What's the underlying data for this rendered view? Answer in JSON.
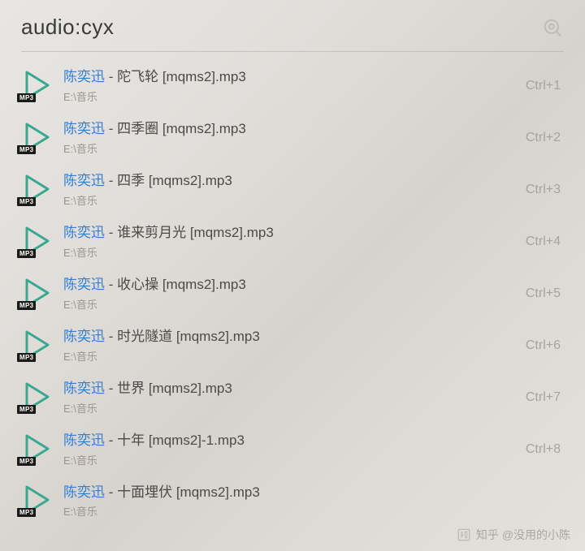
{
  "search": {
    "value": "audio:cyx"
  },
  "icons": {
    "badge": "MP3"
  },
  "results": [
    {
      "artist": "陈奕迅",
      "rest": " - 陀飞轮 [mqms2].mp3",
      "path": "E:\\音乐",
      "shortcut": "Ctrl+1"
    },
    {
      "artist": "陈奕迅",
      "rest": " - 四季圈 [mqms2].mp3",
      "path": "E:\\音乐",
      "shortcut": "Ctrl+2"
    },
    {
      "artist": "陈奕迅",
      "rest": " - 四季 [mqms2].mp3",
      "path": "E:\\音乐",
      "shortcut": "Ctrl+3"
    },
    {
      "artist": "陈奕迅",
      "rest": " - 谁来剪月光 [mqms2].mp3",
      "path": "E:\\音乐",
      "shortcut": "Ctrl+4"
    },
    {
      "artist": "陈奕迅",
      "rest": " - 收心操 [mqms2].mp3",
      "path": "E:\\音乐",
      "shortcut": "Ctrl+5"
    },
    {
      "artist": "陈奕迅",
      "rest": " - 时光隧道 [mqms2].mp3",
      "path": "E:\\音乐",
      "shortcut": "Ctrl+6"
    },
    {
      "artist": "陈奕迅",
      "rest": " - 世界 [mqms2].mp3",
      "path": "E:\\音乐",
      "shortcut": "Ctrl+7"
    },
    {
      "artist": "陈奕迅",
      "rest": " - 十年 [mqms2]-1.mp3",
      "path": "E:\\音乐",
      "shortcut": "Ctrl+8"
    },
    {
      "artist": "陈奕迅",
      "rest": " - 十面埋伏 [mqms2].mp3",
      "path": "E:\\音乐",
      "shortcut": ""
    }
  ],
  "watermark": {
    "text": "知乎 @没用的小陈"
  }
}
